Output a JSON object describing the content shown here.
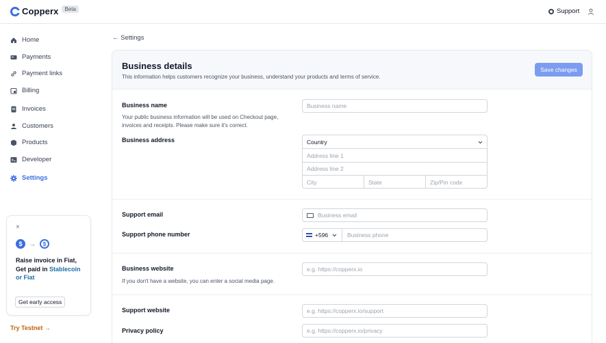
{
  "brand": {
    "name": "Copperx",
    "badge": "Beta"
  },
  "header": {
    "support_label": "Support",
    "user_icon": "user-icon"
  },
  "sidebar": {
    "items": [
      {
        "label": "Home",
        "icon": "home-icon"
      },
      {
        "label": "Payments",
        "icon": "payments-icon"
      },
      {
        "label": "Payment links",
        "icon": "link-icon"
      },
      {
        "label": "Billing",
        "icon": "billing-icon"
      },
      {
        "label": "Invoices",
        "icon": "invoice-icon"
      },
      {
        "label": "Customers",
        "icon": "customers-icon"
      },
      {
        "label": "Products",
        "icon": "products-icon"
      },
      {
        "label": "Developer",
        "icon": "developer-icon"
      },
      {
        "label": "Settings",
        "icon": "settings-icon",
        "active": true
      }
    ],
    "promo": {
      "close": "×",
      "line1": "Raise invoice in Fiat,",
      "line2_prefix": "Get paid in ",
      "line2_highlight": "Stablecoin",
      "line3_highlight": "or Fiat",
      "button": "Get early access"
    },
    "testnet": "Try Testnet  →"
  },
  "back_link": "← Settings",
  "card": {
    "title": "Business details",
    "subtitle": "This information helps customers recognize your business, understand your products and terms of service.",
    "save_button": "Save changes",
    "business_name": {
      "label": "Business name",
      "help": "Your public business information will be used on Checkout page, invoices and receipts. Please make sure it's correct.",
      "placeholder": "Business name"
    },
    "business_address": {
      "label": "Business address",
      "country": "Country",
      "line1": "Address line 1",
      "line2": "Address line 2",
      "city": "City",
      "state": "State",
      "zip": "Zip/Pin code"
    },
    "support_email": {
      "label": "Support email",
      "placeholder": "Business email"
    },
    "support_phone": {
      "label": "Support phone number",
      "code": "+596",
      "placeholder": "Business phone"
    },
    "website": {
      "label": "Business website",
      "help": "If you don't have a website, you can enter a social media page.",
      "placeholder": "e.g. https://copperx.io"
    },
    "support_website": {
      "label": "Support website",
      "placeholder": "e.g. https://copperx.io/support"
    },
    "privacy_policy": {
      "label": "Privacy policy",
      "placeholder": "e.g. https://copperx.io/privacy"
    }
  },
  "colors": {
    "accent": "#3b6fe0",
    "save_button": "#7b9cf0",
    "testnet": "#c2610f",
    "highlight": "#1e6fa8"
  }
}
